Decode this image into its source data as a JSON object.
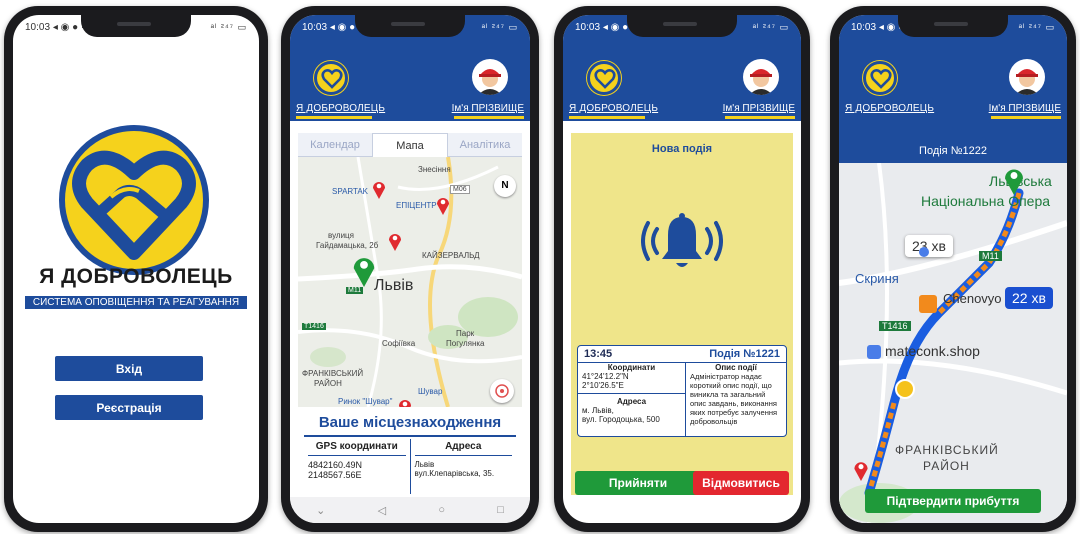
{
  "status": {
    "time": "10:03",
    "icons_left": "◂ ◉ ● ·",
    "icons_right": "ᵃˡ ²⁴⁷ ▭"
  },
  "app": {
    "brand": "Я ДОБРОВОЛЕЦЬ",
    "user_name": "Ім'я ПРІЗВИЩЕ",
    "colors": {
      "primary": "#1e4c9c",
      "accent": "#f5d21c",
      "accept": "#1f9a3a",
      "decline": "#e3272f"
    }
  },
  "screen1": {
    "title": "Я ДОБРОВОЛЕЦЬ",
    "subtitle": "СИСТЕМА ОПОВІЩЕННЯ ТА РЕАГУВАННЯ",
    "login_label": "Вхід",
    "register_label": "Реєстрація"
  },
  "screen2": {
    "tabs": [
      "Календар",
      "Мапа",
      "Аналітика"
    ],
    "active_tab": 1,
    "map_labels": {
      "znesinnia": "Знесіння",
      "spartak": "SPARTAK",
      "epicentr": "ЕПІЦЕНТР",
      "street1": "вулиця",
      "street2": "Гайдамацька, 2б",
      "kaiser": "КАЙЗЕРВАЛЬД",
      "city": "Львів",
      "sofiivka": "Софіївка",
      "park1": "Парк",
      "park2": "Погулянка",
      "district1": "ФРАНКІВСЬКИЙ",
      "district2": "РАЙОН",
      "shuvar": "Шувар",
      "market": "Ринок \"Шувар\"",
      "road1": "М06",
      "road2": "М11",
      "road3": "Т1416",
      "compass": "N"
    },
    "location_title": "Ваше місцезнаходження",
    "gps_header": "GPS координати",
    "gps_line1": "4842160.49N",
    "gps_line2": "2148567.56E",
    "address_header": "Адреса",
    "address_line1": "Львів",
    "address_line2": "вул.Клепарівська, 35."
  },
  "screen3": {
    "title": "Нова подія",
    "time": "13:45",
    "event": "Подія №1221",
    "coords_header": "Координати",
    "coords_line1": "41°24'12.2\"N",
    "coords_line2": "2°10'26.5\"E",
    "address_header": "Адреса",
    "address_line1": "м. Львів,",
    "address_line2": "вул. Городоцька, 500",
    "desc_header": "Опис події",
    "description": "Адміністратор надає короткий опис події, що виникла та загальний опис завдань, виконання яких потребує залучення добровольців",
    "accept_label": "Прийняти",
    "decline_label": "Відмовитись"
  },
  "screen4": {
    "event": "Подія №1222",
    "map_labels": {
      "lvivska1": "Львівська",
      "lvivska2": "Національна Опера",
      "skrynia": "Скриня",
      "chenovo": "Chenovyo",
      "shop": "mateconk.shop",
      "district1": "ФРАНКІВСЬКИЙ",
      "district2": "РАЙОН",
      "road1": "М11",
      "road2": "Т1416"
    },
    "time_alt": "23 хв",
    "time_main": "22 хв",
    "confirm_label": "Підтвердити прибуття"
  }
}
